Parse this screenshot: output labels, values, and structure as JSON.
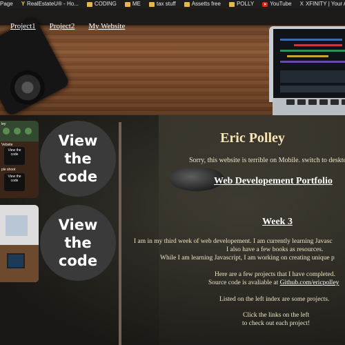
{
  "bookmarks": [
    {
      "label": "Page",
      "icon": "page-icon"
    },
    {
      "label": "RealEstateU® - Ho...",
      "icon": "y-logo-icon"
    },
    {
      "label": "CODING",
      "icon": "folder-icon"
    },
    {
      "label": "ME",
      "icon": "folder-icon"
    },
    {
      "label": "tax stuff",
      "icon": "folder-icon"
    },
    {
      "label": "Assetts free",
      "icon": "folder-icon"
    },
    {
      "label": "POLLY",
      "icon": "folder-icon"
    },
    {
      "label": "YouTube",
      "icon": "youtube-icon"
    },
    {
      "label": "XFINITY | Your Ac",
      "icon": "x-logo-icon"
    }
  ],
  "nav": [
    "Project1",
    "Project2",
    "My Website"
  ],
  "sidebar": {
    "thumb1_labels": [
      "ley",
      "Vebsite",
      "View the code",
      "ple shoot",
      "View the code"
    ],
    "view_code_line1": "View",
    "view_code_line2": "the",
    "view_code_line3": "code"
  },
  "main": {
    "title": "Eric Polley",
    "mobile_note": "Sorry, this website is terrible on Mobile. switch to deskto",
    "portfolio_heading": "Web Developement Portfolio",
    "week_heading": "Week 3",
    "para1_line1": "I am in my third week of web developement. I am currently learning Javasc",
    "para1_line2": "I also have a few books as resources.",
    "para1_line3": "While I am learning Javascript, I am working on creating unique p",
    "para2_line1": "Here are a few projects that I have completed.",
    "para2_line2_prefix": "Source code is avaliable at ",
    "github_link": "Github.com/ericpolley",
    "para3": "Listed on the left index are some projects.",
    "para4_line1": "Click the links on the left",
    "para4_line2": "to check out each project!"
  },
  "colors": {
    "title": "#f6e6b6",
    "text": "#f0e6c8",
    "bookmark_bar": "#1e1e1e"
  }
}
